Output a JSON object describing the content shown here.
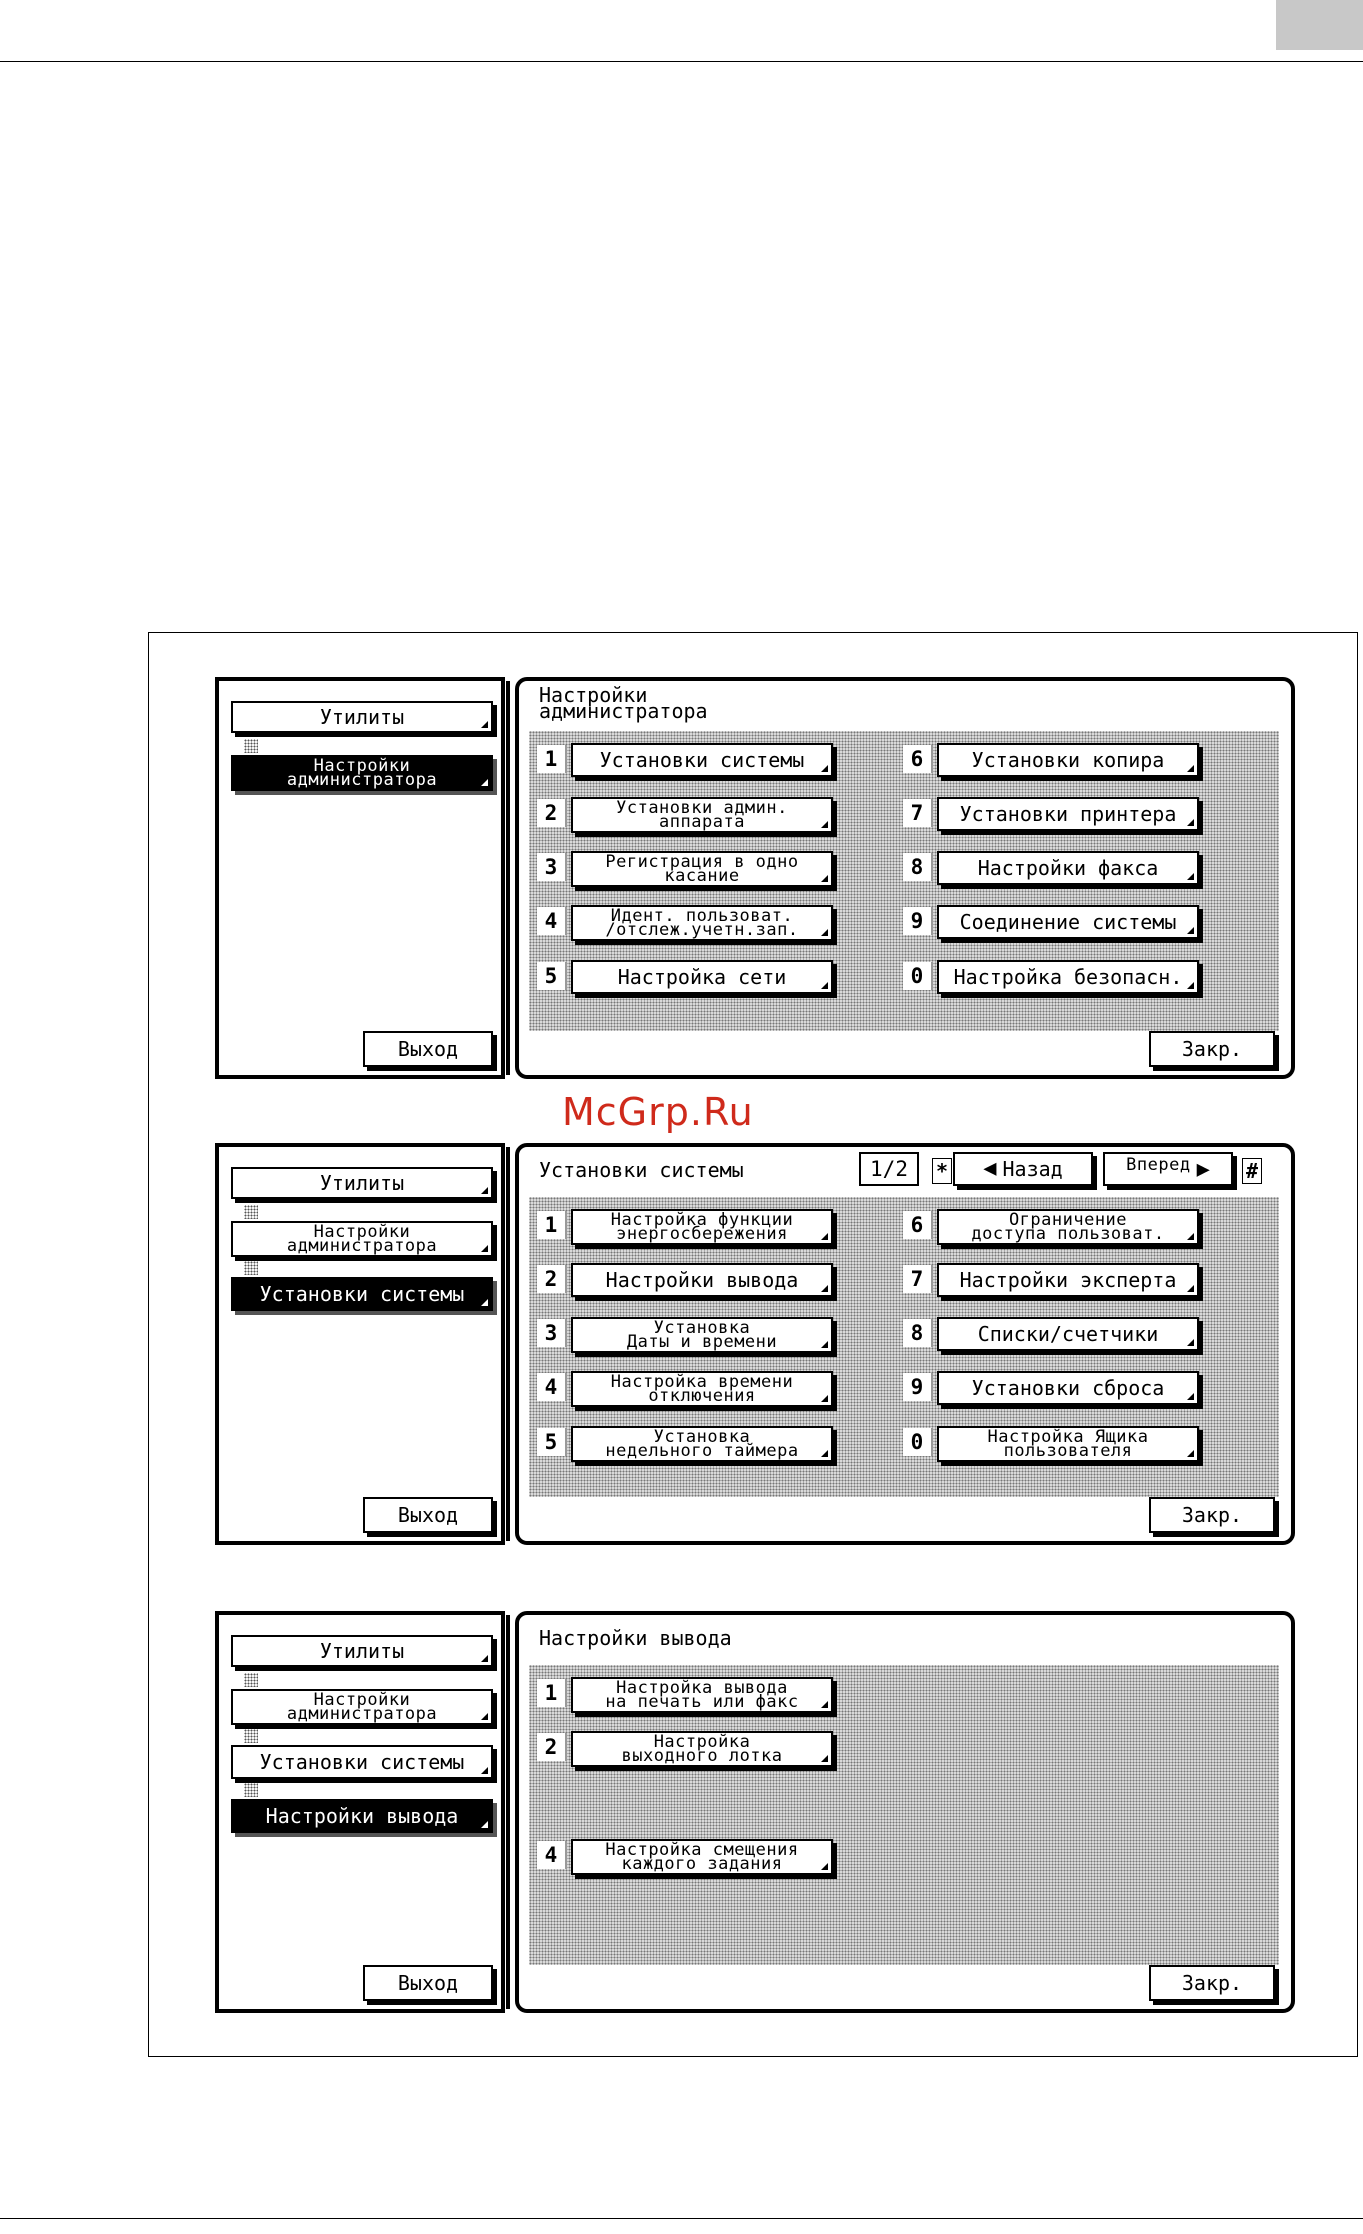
{
  "watermark": "McGrp.Ru",
  "screens": [
    {
      "left": {
        "items": [
          "Утилиты",
          "Настройки\nадминистратора"
        ],
        "exit_label": "Выход"
      },
      "title": "Настройки\nадминистратора",
      "close_label": "Закр.",
      "buttons": [
        {
          "num": "1",
          "label": "Установки системы"
        },
        {
          "num": "2",
          "label": "Установки админ.\nаппарата"
        },
        {
          "num": "3",
          "label": "Регистрация в одно\nкасание"
        },
        {
          "num": "4",
          "label": "Идент. пользоват.\n/отслеж.учетн.зап."
        },
        {
          "num": "5",
          "label": "Настройка сети"
        },
        {
          "num": "6",
          "label": "Установки копира"
        },
        {
          "num": "7",
          "label": "Установки принтера"
        },
        {
          "num": "8",
          "label": "Настройки факса"
        },
        {
          "num": "9",
          "label": "Соединение системы"
        },
        {
          "num": "0",
          "label": "Настройка безопасн."
        }
      ]
    },
    {
      "left": {
        "items": [
          "Утилиты",
          "Настройки\nадминистратора",
          "Установки системы"
        ],
        "exit_label": "Выход"
      },
      "title": "Установки системы",
      "page_indicator": "1/2",
      "star_key": "*",
      "hash_key": "#",
      "back_label": "Назад",
      "forward_label": "Вперед",
      "close_label": "Закр.",
      "buttons": [
        {
          "num": "1",
          "label": "Настройка функции\nэнергосбережения"
        },
        {
          "num": "2",
          "label": "Настройки вывода"
        },
        {
          "num": "3",
          "label": "Установка\nДаты и времени"
        },
        {
          "num": "4",
          "label": "Настройка времени\nотключения"
        },
        {
          "num": "5",
          "label": "Установка\nнедельного таймера"
        },
        {
          "num": "6",
          "label": "Ограничение\nдоступа пользоват."
        },
        {
          "num": "7",
          "label": "Настройки эксперта"
        },
        {
          "num": "8",
          "label": "Списки/счетчики"
        },
        {
          "num": "9",
          "label": "Установки сброса"
        },
        {
          "num": "0",
          "label": "Настройка Ящика\nпользователя"
        }
      ]
    },
    {
      "left": {
        "items": [
          "Утилиты",
          "Настройки\nадминистратора",
          "Установки системы",
          "Настройки вывода"
        ],
        "exit_label": "Выход"
      },
      "title": "Настройки вывода",
      "close_label": "Закр.",
      "buttons": [
        {
          "num": "1",
          "label": "Настройка вывода\nна печать или факс"
        },
        {
          "num": "2",
          "label": "Настройка\nвыходного лотка"
        },
        {
          "num": "4",
          "label": "Настройка смещения\nкаждого задания"
        }
      ]
    }
  ]
}
